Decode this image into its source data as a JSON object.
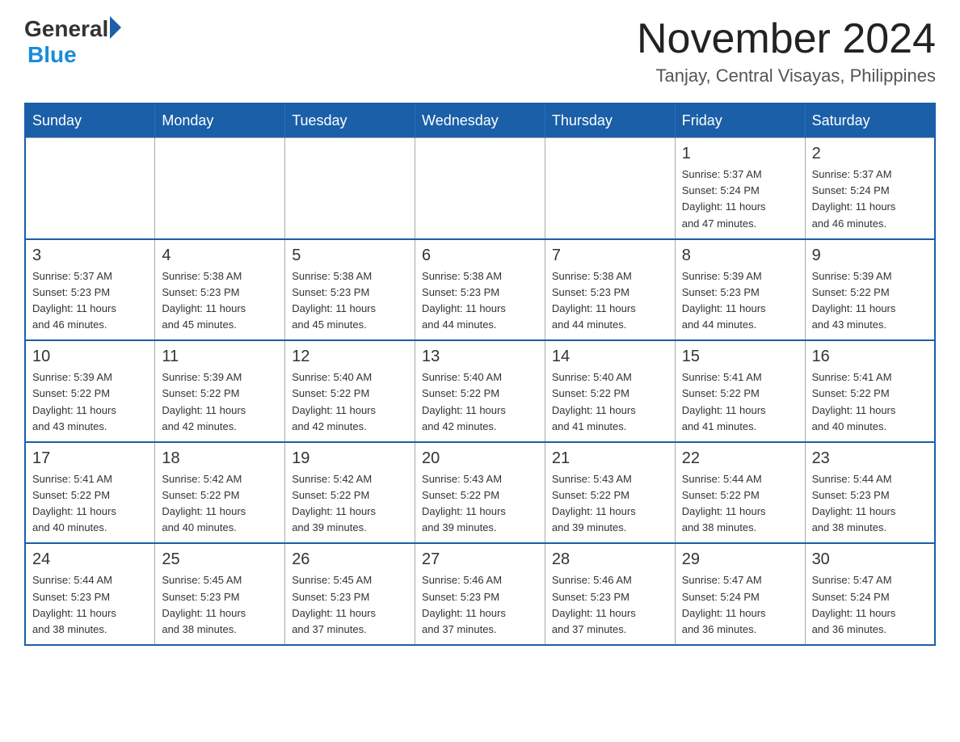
{
  "header": {
    "logo_general": "General",
    "logo_blue": "Blue",
    "month_title": "November 2024",
    "location": "Tanjay, Central Visayas, Philippines"
  },
  "days_of_week": [
    "Sunday",
    "Monday",
    "Tuesday",
    "Wednesday",
    "Thursday",
    "Friday",
    "Saturday"
  ],
  "weeks": [
    [
      {
        "day": "",
        "info": ""
      },
      {
        "day": "",
        "info": ""
      },
      {
        "day": "",
        "info": ""
      },
      {
        "day": "",
        "info": ""
      },
      {
        "day": "",
        "info": ""
      },
      {
        "day": "1",
        "info": "Sunrise: 5:37 AM\nSunset: 5:24 PM\nDaylight: 11 hours\nand 47 minutes."
      },
      {
        "day": "2",
        "info": "Sunrise: 5:37 AM\nSunset: 5:24 PM\nDaylight: 11 hours\nand 46 minutes."
      }
    ],
    [
      {
        "day": "3",
        "info": "Sunrise: 5:37 AM\nSunset: 5:23 PM\nDaylight: 11 hours\nand 46 minutes."
      },
      {
        "day": "4",
        "info": "Sunrise: 5:38 AM\nSunset: 5:23 PM\nDaylight: 11 hours\nand 45 minutes."
      },
      {
        "day": "5",
        "info": "Sunrise: 5:38 AM\nSunset: 5:23 PM\nDaylight: 11 hours\nand 45 minutes."
      },
      {
        "day": "6",
        "info": "Sunrise: 5:38 AM\nSunset: 5:23 PM\nDaylight: 11 hours\nand 44 minutes."
      },
      {
        "day": "7",
        "info": "Sunrise: 5:38 AM\nSunset: 5:23 PM\nDaylight: 11 hours\nand 44 minutes."
      },
      {
        "day": "8",
        "info": "Sunrise: 5:39 AM\nSunset: 5:23 PM\nDaylight: 11 hours\nand 44 minutes."
      },
      {
        "day": "9",
        "info": "Sunrise: 5:39 AM\nSunset: 5:22 PM\nDaylight: 11 hours\nand 43 minutes."
      }
    ],
    [
      {
        "day": "10",
        "info": "Sunrise: 5:39 AM\nSunset: 5:22 PM\nDaylight: 11 hours\nand 43 minutes."
      },
      {
        "day": "11",
        "info": "Sunrise: 5:39 AM\nSunset: 5:22 PM\nDaylight: 11 hours\nand 42 minutes."
      },
      {
        "day": "12",
        "info": "Sunrise: 5:40 AM\nSunset: 5:22 PM\nDaylight: 11 hours\nand 42 minutes."
      },
      {
        "day": "13",
        "info": "Sunrise: 5:40 AM\nSunset: 5:22 PM\nDaylight: 11 hours\nand 42 minutes."
      },
      {
        "day": "14",
        "info": "Sunrise: 5:40 AM\nSunset: 5:22 PM\nDaylight: 11 hours\nand 41 minutes."
      },
      {
        "day": "15",
        "info": "Sunrise: 5:41 AM\nSunset: 5:22 PM\nDaylight: 11 hours\nand 41 minutes."
      },
      {
        "day": "16",
        "info": "Sunrise: 5:41 AM\nSunset: 5:22 PM\nDaylight: 11 hours\nand 40 minutes."
      }
    ],
    [
      {
        "day": "17",
        "info": "Sunrise: 5:41 AM\nSunset: 5:22 PM\nDaylight: 11 hours\nand 40 minutes."
      },
      {
        "day": "18",
        "info": "Sunrise: 5:42 AM\nSunset: 5:22 PM\nDaylight: 11 hours\nand 40 minutes."
      },
      {
        "day": "19",
        "info": "Sunrise: 5:42 AM\nSunset: 5:22 PM\nDaylight: 11 hours\nand 39 minutes."
      },
      {
        "day": "20",
        "info": "Sunrise: 5:43 AM\nSunset: 5:22 PM\nDaylight: 11 hours\nand 39 minutes."
      },
      {
        "day": "21",
        "info": "Sunrise: 5:43 AM\nSunset: 5:22 PM\nDaylight: 11 hours\nand 39 minutes."
      },
      {
        "day": "22",
        "info": "Sunrise: 5:44 AM\nSunset: 5:22 PM\nDaylight: 11 hours\nand 38 minutes."
      },
      {
        "day": "23",
        "info": "Sunrise: 5:44 AM\nSunset: 5:23 PM\nDaylight: 11 hours\nand 38 minutes."
      }
    ],
    [
      {
        "day": "24",
        "info": "Sunrise: 5:44 AM\nSunset: 5:23 PM\nDaylight: 11 hours\nand 38 minutes."
      },
      {
        "day": "25",
        "info": "Sunrise: 5:45 AM\nSunset: 5:23 PM\nDaylight: 11 hours\nand 38 minutes."
      },
      {
        "day": "26",
        "info": "Sunrise: 5:45 AM\nSunset: 5:23 PM\nDaylight: 11 hours\nand 37 minutes."
      },
      {
        "day": "27",
        "info": "Sunrise: 5:46 AM\nSunset: 5:23 PM\nDaylight: 11 hours\nand 37 minutes."
      },
      {
        "day": "28",
        "info": "Sunrise: 5:46 AM\nSunset: 5:23 PM\nDaylight: 11 hours\nand 37 minutes."
      },
      {
        "day": "29",
        "info": "Sunrise: 5:47 AM\nSunset: 5:24 PM\nDaylight: 11 hours\nand 36 minutes."
      },
      {
        "day": "30",
        "info": "Sunrise: 5:47 AM\nSunset: 5:24 PM\nDaylight: 11 hours\nand 36 minutes."
      }
    ]
  ]
}
